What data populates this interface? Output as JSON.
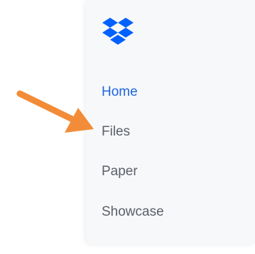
{
  "sidebar": {
    "logo_icon": "dropbox-logo-icon",
    "brand_color": "#0061fe",
    "items": [
      {
        "label": "Home",
        "active": true
      },
      {
        "label": "Files",
        "active": false
      },
      {
        "label": "Paper",
        "active": false
      },
      {
        "label": "Showcase",
        "active": false
      }
    ]
  },
  "annotation": {
    "icon": "arrow-pointer-icon",
    "color": "#f28c38"
  },
  "colors": {
    "active_item": "#1e66dd",
    "inactive_item": "#5b6068",
    "sidebar_background": "#f7f8fa"
  }
}
